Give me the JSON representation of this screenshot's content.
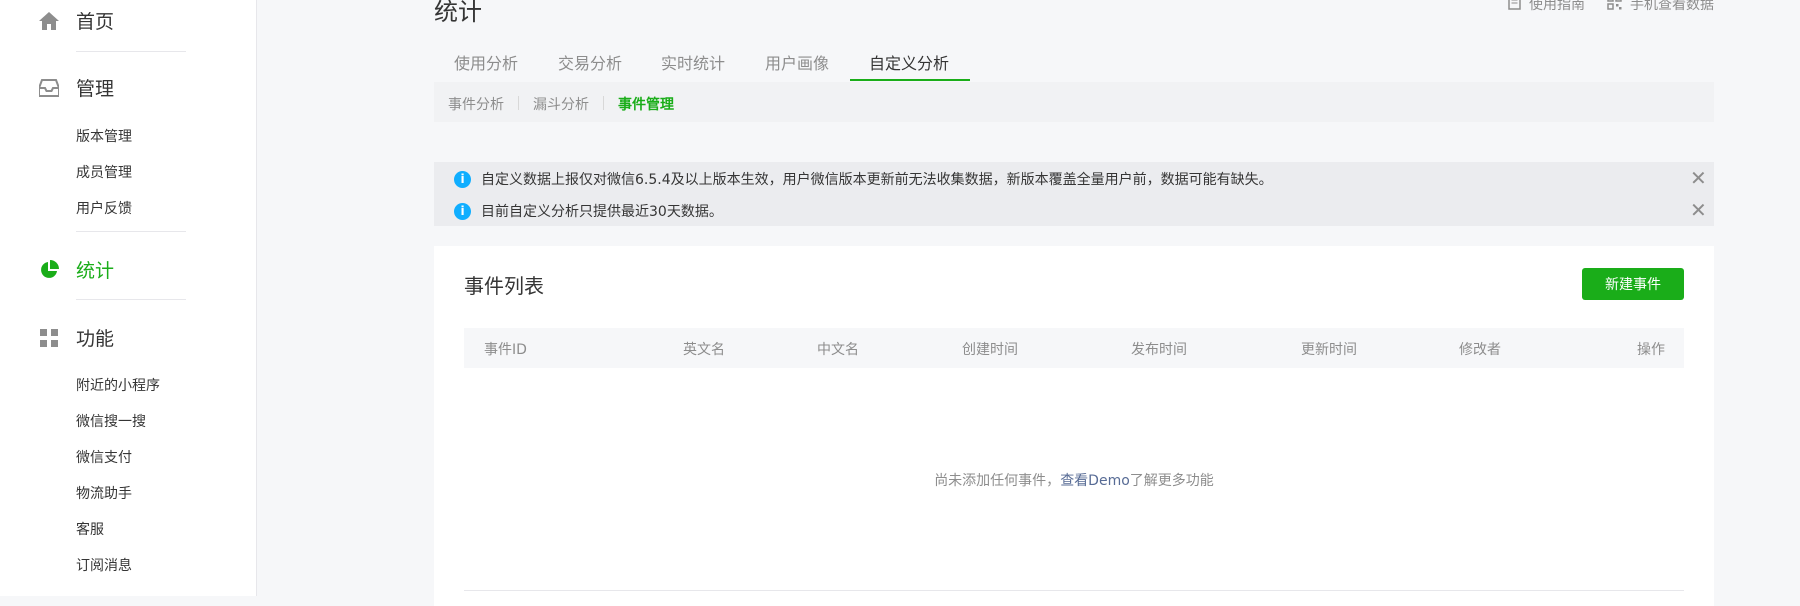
{
  "sidebar": {
    "home": {
      "label": "首页",
      "icon": "home-icon"
    },
    "management": {
      "label": "管理",
      "icon": "inbox-icon",
      "items": [
        "版本管理",
        "成员管理",
        "用户反馈"
      ]
    },
    "stats": {
      "label": "统计",
      "icon": "pie-chart-icon",
      "active": true
    },
    "features": {
      "label": "功能",
      "icon": "grid-icon",
      "items": [
        "附近的小程序",
        "微信搜一搜",
        "微信支付",
        "物流助手",
        "客服",
        "订阅消息"
      ]
    }
  },
  "header": {
    "title": "统计",
    "links": [
      {
        "label": "使用指南",
        "icon": "document-icon"
      },
      {
        "label": "手机查看数据",
        "icon": "qr-code-icon"
      }
    ]
  },
  "tabs": [
    "使用分析",
    "交易分析",
    "实时统计",
    "用户画像",
    "自定义分析"
  ],
  "active_tab": "自定义分析",
  "subtabs": [
    "事件分析",
    "漏斗分析",
    "事件管理"
  ],
  "active_subtab": "事件管理",
  "notices": [
    "自定义数据上报仅对微信6.5.4及以上版本生效，用户微信版本更新前无法收集数据，新版本覆盖全量用户前，数据可能有缺失。",
    "目前自定义分析只提供最近30天数据。"
  ],
  "event_list": {
    "title": "事件列表",
    "new_button": "新建事件",
    "columns": [
      "事件ID",
      "英文名",
      "中文名",
      "创建时间",
      "发布时间",
      "更新时间",
      "修改者",
      "操作"
    ],
    "empty": {
      "prefix": "尚未添加任何事件，",
      "link": "查看Demo",
      "suffix": "了解更多功能"
    }
  },
  "colors": {
    "accent": "#1aad19",
    "info": "#10aeff",
    "link": "#576b95"
  }
}
